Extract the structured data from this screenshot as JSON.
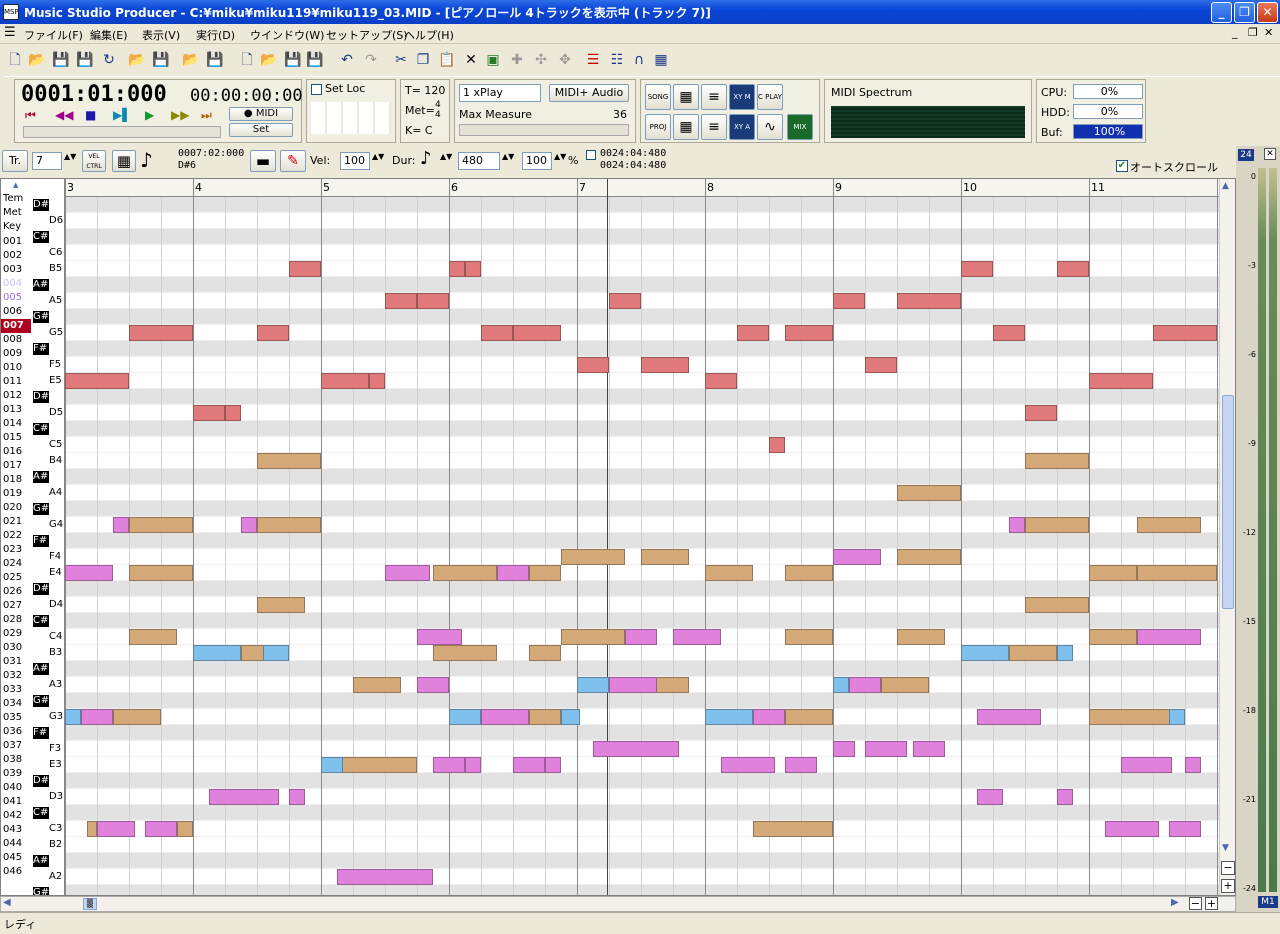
{
  "window": {
    "title": "Music Studio Producer - C:¥miku¥miku119¥miku119_03.MID - [ピアノロール 4トラックを表示中 (トラック 7)]",
    "icon": "MSP"
  },
  "menu": [
    "ファイル(F)",
    "編集(E)",
    "表示(V)",
    "実行(D)",
    "ウインドウ(W)",
    "セットアップ(S)",
    "ヘルプ(H)"
  ],
  "transport": {
    "position": "0001:01:000",
    "time": "00:00:00:00",
    "midi_label": "● MIDI",
    "set_label": "Set",
    "set_loc": "Set Loc",
    "tempo": "T= 120",
    "meter_label": "Met=",
    "meter_num": "4",
    "meter_den": "4",
    "key": "K=  C",
    "play_mode": "1 xPlay",
    "output": "MIDI+ Audio",
    "max_measure_label": "Max Measure",
    "max_measure": "36",
    "spectrum_title": "MIDI Spectrum",
    "cpu_label": "CPU:",
    "cpu": "0%",
    "hdd_label": "HDD:",
    "hdd": "0%",
    "buf_label": "Buf:",
    "buf": "100%",
    "mode_buttons": [
      "SONG",
      "PROJ",
      "C PLAY",
      "XY M",
      "XY A",
      "MIX"
    ]
  },
  "trackbar": {
    "tr_label": "Tr.",
    "track": "7",
    "vel_ctrl": "VEL CTRL",
    "pos1": "0007:02:000",
    "pos1_note": "D#6",
    "vel_label": "Vel:",
    "vel": "100",
    "dur_label": "Dur:",
    "dur": "480",
    "gate": "100",
    "gate_unit": "%",
    "pos2": "0024:04:480",
    "pos3": "0024:04:480",
    "autoscroll": "オートスクロール",
    "zoom_badge": "24"
  },
  "keyheader": [
    "Tem",
    "Met",
    "Key"
  ],
  "rows": [
    "D#",
    "D6",
    "C#",
    "C6",
    "B5",
    "A#",
    "A5",
    "G#",
    "G5",
    "F#",
    "F5",
    "E5",
    "D#",
    "D5",
    "C#",
    "C5",
    "B4",
    "A#",
    "A4",
    "G#",
    "G4",
    "F#",
    "F4",
    "E4",
    "D#",
    "D4",
    "C#",
    "C4",
    "B3",
    "A#",
    "A3",
    "G#",
    "G3",
    "F#",
    "F3",
    "E3",
    "D#",
    "D3",
    "C#",
    "C3",
    "B2",
    "A#",
    "A2",
    "G#"
  ],
  "track_numbers": [
    "001",
    "002",
    "003",
    "004",
    "005",
    "006",
    "007",
    "008",
    "009",
    "010",
    "011",
    "012",
    "013",
    "014",
    "015",
    "016",
    "017",
    "018",
    "019",
    "020",
    "021",
    "022",
    "023",
    "024",
    "025",
    "026",
    "027",
    "028",
    "029",
    "030",
    "031",
    "032",
    "033",
    "034",
    "035",
    "036",
    "037",
    "038",
    "039",
    "040",
    "041",
    "042",
    "043",
    "044",
    "045",
    "046"
  ],
  "active_track": "007",
  "measures": [
    "3",
    "4",
    "5",
    "6",
    "7",
    "8",
    "9",
    "10",
    "11"
  ],
  "meter_scale": [
    "0",
    "-3",
    "-6",
    "-9",
    "-12",
    "-15",
    "-18",
    "-21",
    "-24"
  ],
  "meter_channel": "M1",
  "colors": {
    "track_red": "#e07a7a",
    "track_tan": "#d4a97a",
    "track_pink": "#e082dc",
    "track_blue": "#7fbfec",
    "grid_dark": "#e2e2e2"
  },
  "notes": [
    {
      "c": "track_red",
      "r": 11,
      "s": 0,
      "l": 2
    },
    {
      "c": "track_red",
      "r": 8,
      "s": 2,
      "l": 2
    },
    {
      "c": "track_red",
      "r": 4,
      "s": 7,
      "l": 1
    },
    {
      "c": "track_red",
      "r": 8,
      "s": 6,
      "l": 1
    },
    {
      "c": "track_red",
      "r": 13,
      "s": 4,
      "l": 1
    },
    {
      "c": "track_red",
      "r": 13,
      "s": 5,
      "l": 0.5
    },
    {
      "c": "track_red",
      "r": 6,
      "s": 10,
      "l": 1
    },
    {
      "c": "track_red",
      "r": 6,
      "s": 11,
      "l": 1
    },
    {
      "c": "track_red",
      "r": 11,
      "s": 8,
      "l": 1.5
    },
    {
      "c": "track_red",
      "r": 11,
      "s": 9.5,
      "l": 0.5
    },
    {
      "c": "track_red",
      "r": 4,
      "s": 12,
      "l": 0.5
    },
    {
      "c": "track_red",
      "r": 4,
      "s": 12.5,
      "l": 0.5
    },
    {
      "c": "track_red",
      "r": 8,
      "s": 13,
      "l": 1
    },
    {
      "c": "track_red",
      "r": 8,
      "s": 14,
      "l": 1.5
    },
    {
      "c": "track_red",
      "r": 10,
      "s": 16,
      "l": 1
    },
    {
      "c": "track_red",
      "r": 6,
      "s": 17,
      "l": 1
    },
    {
      "c": "track_red",
      "r": 10,
      "s": 18,
      "l": 1.5
    },
    {
      "c": "track_red",
      "r": 11,
      "s": 20,
      "l": 1
    },
    {
      "c": "track_red",
      "r": 15,
      "s": 22,
      "l": 0.5
    },
    {
      "c": "track_red",
      "r": 8,
      "s": 21,
      "l": 1
    },
    {
      "c": "track_red",
      "r": 8,
      "s": 22.5,
      "l": 1.5
    },
    {
      "c": "track_red",
      "r": 6,
      "s": 24,
      "l": 1
    },
    {
      "c": "track_red",
      "r": 10,
      "s": 25,
      "l": 1
    },
    {
      "c": "track_red",
      "r": 6,
      "s": 26,
      "l": 2
    },
    {
      "c": "track_red",
      "r": 4,
      "s": 28,
      "l": 1
    },
    {
      "c": "track_red",
      "r": 8,
      "s": 29,
      "l": 1
    },
    {
      "c": "track_red",
      "r": 13,
      "s": 30,
      "l": 1
    },
    {
      "c": "track_red",
      "r": 4,
      "s": 31,
      "l": 1
    },
    {
      "c": "track_red",
      "r": 11,
      "s": 32,
      "l": 2
    },
    {
      "c": "track_red",
      "r": 8,
      "s": 34,
      "l": 2
    },
    {
      "c": "track_tan",
      "r": 20,
      "s": 2,
      "l": 2
    },
    {
      "c": "track_tan",
      "r": 23,
      "s": 2,
      "l": 2
    },
    {
      "c": "track_tan",
      "r": 27,
      "s": 2,
      "l": 1.5
    },
    {
      "c": "track_tan",
      "r": 39,
      "s": 0.7,
      "l": 0.3
    },
    {
      "c": "track_tan",
      "r": 32,
      "s": 1.5,
      "l": 1.5
    },
    {
      "c": "track_tan",
      "r": 16,
      "s": 6,
      "l": 2
    },
    {
      "c": "track_tan",
      "r": 20,
      "s": 6,
      "l": 2
    },
    {
      "c": "track_tan",
      "r": 25,
      "s": 6,
      "l": 1.5
    },
    {
      "c": "track_tan",
      "r": 28,
      "s": 5.5,
      "l": 1.5
    },
    {
      "c": "track_tan",
      "r": 39,
      "s": 3.5,
      "l": 0.5
    },
    {
      "c": "track_tan",
      "r": 35,
      "s": 8.5,
      "l": 2.5
    },
    {
      "c": "track_tan",
      "r": 30,
      "s": 9,
      "l": 1.5
    },
    {
      "c": "track_tan",
      "r": 23,
      "s": 11.5,
      "l": 2
    },
    {
      "c": "track_tan",
      "r": 23,
      "s": 14.5,
      "l": 1
    },
    {
      "c": "track_tan",
      "r": 28,
      "s": 11.5,
      "l": 2
    },
    {
      "c": "track_tan",
      "r": 28,
      "s": 14.5,
      "l": 1
    },
    {
      "c": "track_tan",
      "r": 22,
      "s": 15.5,
      "l": 2
    },
    {
      "c": "track_tan",
      "r": 22,
      "s": 18,
      "l": 1.5
    },
    {
      "c": "track_tan",
      "r": 27,
      "s": 15.5,
      "l": 2
    },
    {
      "c": "track_tan",
      "r": 30,
      "s": 18,
      "l": 1.5
    },
    {
      "c": "track_tan",
      "r": 32,
      "s": 14.5,
      "l": 1
    },
    {
      "c": "track_tan",
      "r": 23,
      "s": 20,
      "l": 1.5
    },
    {
      "c": "track_tan",
      "r": 23,
      "s": 22.5,
      "l": 1.5
    },
    {
      "c": "track_tan",
      "r": 27,
      "s": 22.5,
      "l": 1.5
    },
    {
      "c": "track_tan",
      "r": 18,
      "s": 26,
      "l": 2
    },
    {
      "c": "track_tan",
      "r": 22,
      "s": 26,
      "l": 2
    },
    {
      "c": "track_tan",
      "r": 27,
      "s": 26,
      "l": 1.5
    },
    {
      "c": "track_tan",
      "r": 30,
      "s": 25.5,
      "l": 1.5
    },
    {
      "c": "track_tan",
      "r": 39,
      "s": 21.5,
      "l": 2.5
    },
    {
      "c": "track_tan",
      "r": 32,
      "s": 22.5,
      "l": 1.5
    },
    {
      "c": "track_tan",
      "r": 16,
      "s": 30,
      "l": 2
    },
    {
      "c": "track_tan",
      "r": 20,
      "s": 30,
      "l": 2
    },
    {
      "c": "track_tan",
      "r": 25,
      "s": 30,
      "l": 2
    },
    {
      "c": "track_tan",
      "r": 28,
      "s": 29.5,
      "l": 1.5
    },
    {
      "c": "track_tan",
      "r": 20,
      "s": 33.5,
      "l": 2
    },
    {
      "c": "track_tan",
      "r": 23,
      "s": 33.5,
      "l": 2.5
    },
    {
      "c": "track_tan",
      "r": 27,
      "s": 32,
      "l": 1.5
    },
    {
      "c": "track_tan",
      "r": 32,
      "s": 32,
      "l": 3
    },
    {
      "c": "track_tan",
      "r": 23,
      "s": 32,
      "l": 1.5
    },
    {
      "c": "track_pink",
      "r": 23,
      "s": 0,
      "l": 1.5
    },
    {
      "c": "track_pink",
      "r": 20,
      "s": 1.5,
      "l": 0.5
    },
    {
      "c": "track_pink",
      "r": 20,
      "s": 5.5,
      "l": 0.5
    },
    {
      "c": "track_pink",
      "r": 32,
      "s": 0.5,
      "l": 1
    },
    {
      "c": "track_pink",
      "r": 39,
      "s": 1,
      "l": 1.2
    },
    {
      "c": "track_pink",
      "r": 39,
      "s": 2.5,
      "l": 1
    },
    {
      "c": "track_pink",
      "r": 37,
      "s": 4.5,
      "l": 2.2
    },
    {
      "c": "track_pink",
      "r": 37,
      "s": 7,
      "l": 0.5
    },
    {
      "c": "track_pink",
      "r": 42,
      "s": 8.5,
      "l": 3
    },
    {
      "c": "track_pink",
      "r": 23,
      "s": 10,
      "l": 1.4
    },
    {
      "c": "track_pink",
      "r": 23,
      "s": 13.5,
      "l": 1
    },
    {
      "c": "track_pink",
      "r": 27,
      "s": 11,
      "l": 1.4
    },
    {
      "c": "track_pink",
      "r": 30,
      "s": 11,
      "l": 1
    },
    {
      "c": "track_pink",
      "r": 35,
      "s": 11.5,
      "l": 1
    },
    {
      "c": "track_pink",
      "r": 35,
      "s": 12.5,
      "l": 0.5
    },
    {
      "c": "track_pink",
      "r": 35,
      "s": 14,
      "l": 1
    },
    {
      "c": "track_pink",
      "r": 35,
      "s": 15,
      "l": 0.5
    },
    {
      "c": "track_pink",
      "r": 32,
      "s": 13,
      "l": 1.5
    },
    {
      "c": "track_pink",
      "r": 34,
      "s": 16.5,
      "l": 2.7
    },
    {
      "c": "track_pink",
      "r": 30,
      "s": 17,
      "l": 1.5
    },
    {
      "c": "track_pink",
      "r": 27,
      "s": 17.5,
      "l": 1
    },
    {
      "c": "track_pink",
      "r": 27,
      "s": 19,
      "l": 1.5
    },
    {
      "c": "track_pink",
      "r": 22,
      "s": 24,
      "l": 1.5
    },
    {
      "c": "track_pink",
      "r": 34,
      "s": 24,
      "l": 0.7
    },
    {
      "c": "track_pink",
      "r": 34,
      "s": 25,
      "l": 1.3
    },
    {
      "c": "track_pink",
      "r": 34,
      "s": 26.5,
      "l": 1
    },
    {
      "c": "track_pink",
      "r": 35,
      "s": 20.5,
      "l": 1.7
    },
    {
      "c": "track_pink",
      "r": 35,
      "s": 22.5,
      "l": 1
    },
    {
      "c": "track_pink",
      "r": 32,
      "s": 21.5,
      "l": 1
    },
    {
      "c": "track_pink",
      "r": 30,
      "s": 24.5,
      "l": 1
    },
    {
      "c": "track_pink",
      "r": 32,
      "s": 28.5,
      "l": 2
    },
    {
      "c": "track_pink",
      "r": 37,
      "s": 28.5,
      "l": 0.8
    },
    {
      "c": "track_pink",
      "r": 37,
      "s": 31,
      "l": 0.5
    },
    {
      "c": "track_pink",
      "r": 27,
      "s": 33.5,
      "l": 2
    },
    {
      "c": "track_pink",
      "r": 35,
      "s": 33,
      "l": 1.6
    },
    {
      "c": "track_pink",
      "r": 35,
      "s": 35,
      "l": 0.5
    },
    {
      "c": "track_pink",
      "r": 39,
      "s": 32.5,
      "l": 1.7
    },
    {
      "c": "track_pink",
      "r": 39,
      "s": 34.5,
      "l": 1
    },
    {
      "c": "track_pink",
      "r": 20,
      "s": 29.5,
      "l": 0.5
    },
    {
      "c": "track_pink",
      "r": 42,
      "s": 8.5,
      "l": 3
    },
    {
      "c": "track_blue",
      "r": 28,
      "s": 4,
      "l": 1.5
    },
    {
      "c": "track_blue",
      "r": 28,
      "s": 6.2,
      "l": 0.8
    },
    {
      "c": "track_blue",
      "r": 32,
      "s": 0,
      "l": 0.5
    },
    {
      "c": "track_blue",
      "r": 35,
      "s": 8,
      "l": 0.7
    },
    {
      "c": "track_blue",
      "r": 32,
      "s": 12,
      "l": 1
    },
    {
      "c": "track_blue",
      "r": 32,
      "s": 15.5,
      "l": 0.6
    },
    {
      "c": "track_blue",
      "r": 30,
      "s": 16,
      "l": 1
    },
    {
      "c": "track_blue",
      "r": 32,
      "s": 20,
      "l": 1.5
    },
    {
      "c": "track_blue",
      "r": 30,
      "s": 24,
      "l": 0.5
    },
    {
      "c": "track_blue",
      "r": 28,
      "s": 28,
      "l": 1.5
    },
    {
      "c": "track_blue",
      "r": 28,
      "s": 31,
      "l": 0.5
    },
    {
      "c": "track_blue",
      "r": 32,
      "s": 34.5,
      "l": 0.5
    }
  ],
  "hscroll_label": "▒",
  "status": "レディ"
}
